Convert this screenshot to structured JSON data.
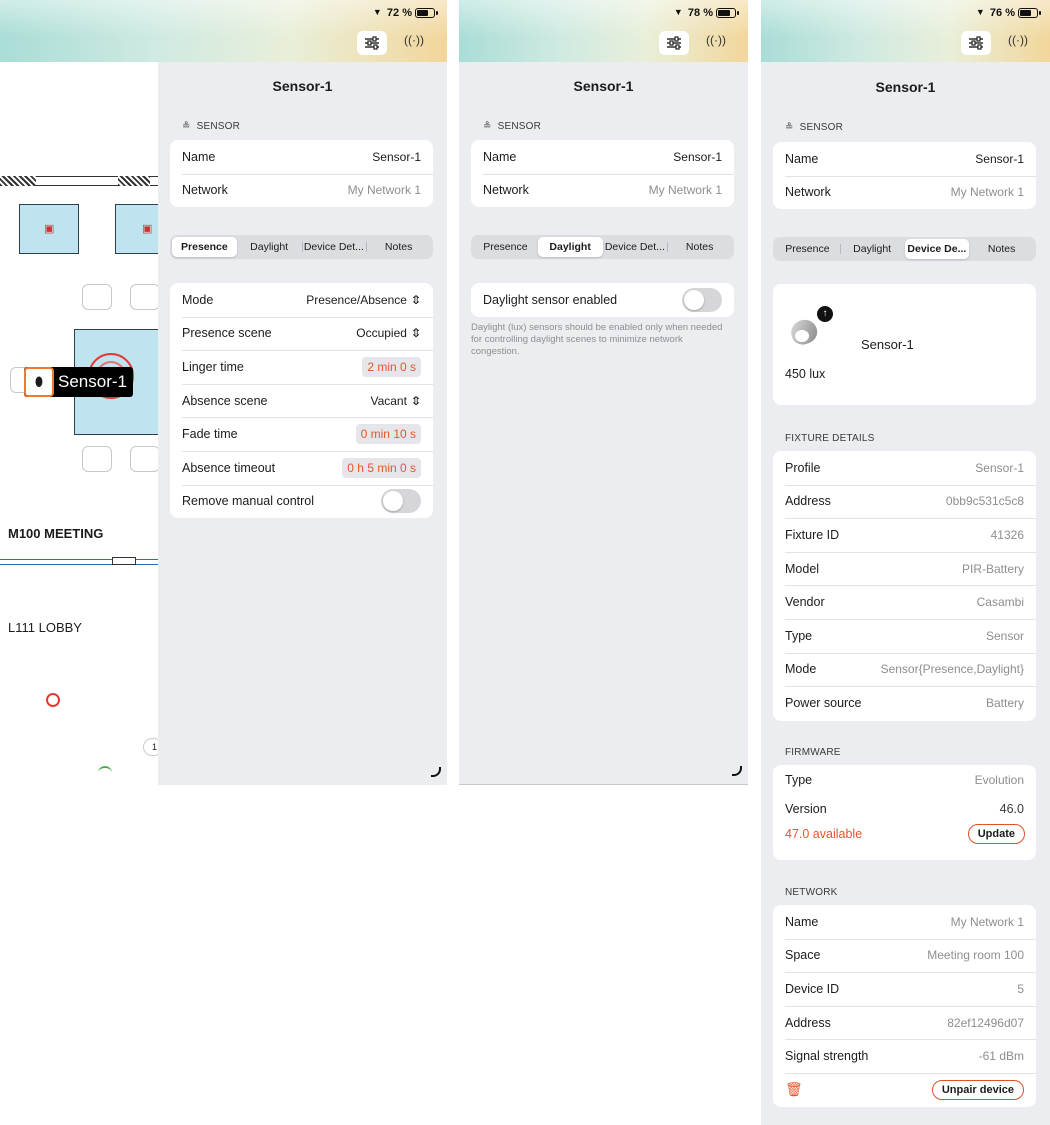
{
  "screens": [
    {
      "battery": "72 %",
      "battery_fill": 0.72
    },
    {
      "battery": "78 %",
      "battery_fill": 0.78
    },
    {
      "battery": "76 %",
      "battery_fill": 0.76
    }
  ],
  "title": "Sensor-1",
  "sensor_section": "SENSOR",
  "sensor_rows": {
    "name_label": "Name",
    "name_value": "Sensor-1",
    "network_label": "Network",
    "network_value": "My Network 1"
  },
  "tabs": [
    "Presence",
    "Daylight",
    "Device Det...",
    "Notes"
  ],
  "tabs_s3": [
    "Presence",
    "Daylight",
    "Device De...",
    "Notes"
  ],
  "floorplan": {
    "sensor_label": "Sensor-1",
    "room_meeting": "M100 MEETING",
    "room_lobby": "L111 LOBBY",
    "badge": "1"
  },
  "presence": {
    "mode_label": "Mode",
    "mode_value": "Presence/Absence",
    "presence_scene_label": "Presence scene",
    "presence_scene_value": "Occupied",
    "linger_label": "Linger time",
    "linger_value": "2 min 0 s",
    "absence_scene_label": "Absence scene",
    "absence_scene_value": "Vacant",
    "fade_label": "Fade time",
    "fade_value": "0 min 10 s",
    "absence_timeout_label": "Absence timeout",
    "absence_timeout_value": "0 h 5 min 0 s",
    "remove_manual_label": "Remove manual control",
    "remove_manual_on": false
  },
  "daylight": {
    "enabled_label": "Daylight sensor enabled",
    "enabled": false,
    "help": "Daylight (lux) sensors should be enabled only when needed for controlling daylight scenes to minimize network congestion."
  },
  "device": {
    "name": "Sensor-1",
    "lux": "450 lux",
    "fixture_section": "FIXTURE DETAILS",
    "fixture_rows": [
      {
        "label": "Profile",
        "value": "Sensor-1"
      },
      {
        "label": "Address",
        "value": "0bb9c531c5c8"
      },
      {
        "label": "Fixture ID",
        "value": "41326"
      },
      {
        "label": "Model",
        "value": "PIR-Battery"
      },
      {
        "label": "Vendor",
        "value": "Casambi"
      },
      {
        "label": "Type",
        "value": "Sensor"
      },
      {
        "label": "Mode",
        "value": "Sensor{Presence,Daylight}"
      },
      {
        "label": "Power source",
        "value": "Battery"
      }
    ],
    "firmware_section": "FIRMWARE",
    "fw_type_label": "Type",
    "fw_type_value": "Evolution",
    "fw_version_label": "Version",
    "fw_version_value": "46.0",
    "fw_available": "47.0 available",
    "fw_update": "Update",
    "network_section": "NETWORK",
    "network_rows": [
      {
        "label": "Name",
        "value": "My Network 1"
      },
      {
        "label": "Space",
        "value": "Meeting room 100"
      },
      {
        "label": "Device ID",
        "value": "5"
      },
      {
        "label": "Address",
        "value": "82ef12496d07"
      },
      {
        "label": "Signal strength",
        "value": "-61 dBm"
      }
    ],
    "unpair": "Unpair device"
  },
  "colors": {
    "accent": "#e4572e",
    "panel_bg": "#ebedf0",
    "room_fill": "#bfe3ef"
  }
}
